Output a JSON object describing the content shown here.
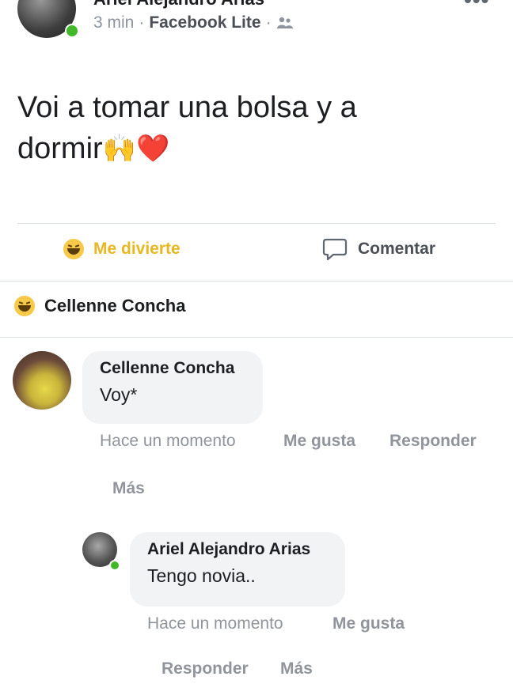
{
  "post": {
    "author": "Ariel Alejandro Arias",
    "time": "3 min",
    "separator": "·",
    "app": "Facebook Lite",
    "privacy_icon": "friends-icon",
    "text_line1": "Voi a tomar una bolsa y a",
    "text_line2": "dormir",
    "emoji_hands": "🙌",
    "emoji_heart": "❤️"
  },
  "actions": {
    "react_label": "Me divierte",
    "comment_label": "Comentar"
  },
  "reactors": {
    "name": "Cellenne Concha"
  },
  "comments": [
    {
      "name": "Cellenne Concha",
      "text": "Voy*",
      "time": "Hace un momento",
      "like": "Me gusta",
      "reply": "Responder",
      "more": "Más"
    },
    {
      "name": "Ariel Alejandro Arias",
      "text": "Tengo novia..",
      "time": "Hace un momento",
      "like": "Me gusta",
      "reply": "Responder",
      "more": "Más"
    }
  ],
  "colors": {
    "haha_yellow": "#f7c948",
    "online_green": "#42b72a",
    "bubble_gray": "#f2f3f5",
    "meta_gray": "#90949c",
    "accent_reaction": "#e8b722"
  }
}
